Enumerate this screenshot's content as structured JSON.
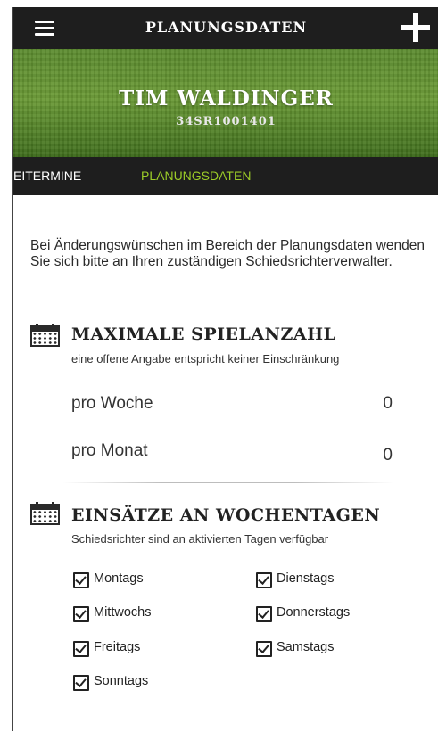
{
  "topbar": {
    "title": "PLANUNGSDATEN",
    "menu_icon": "hamburger-menu-icon",
    "add_icon": "plus-icon"
  },
  "profile": {
    "name": "TIM WALDINGER",
    "id": "34SR1001401"
  },
  "tabs": [
    {
      "label": "EITERMINE",
      "active": false
    },
    {
      "label": "PLANUNGSDATEN",
      "active": true
    }
  ],
  "intro": "Bei Änderungswünschen im Bereich der Planungsdaten wenden Sie sich bitte an Ihren zuständigen Schiedsrichterverwalter.",
  "max_games": {
    "icon": "calendar-icon",
    "title": "MAXIMALE SPIELANZAHL",
    "subtitle": "eine offene Angabe entspricht keiner Einschränkung",
    "rows": [
      {
        "label": "pro Woche",
        "value": "0"
      },
      {
        "label": "pro Monat",
        "value": "0"
      }
    ]
  },
  "weekdays": {
    "icon": "calendar-icon",
    "title": "EINSÄTZE AN WOCHENTAGEN",
    "subtitle": "Schiedsrichter sind an aktivierten Tagen verfügbar",
    "days": [
      {
        "label": "Montags",
        "checked": true
      },
      {
        "label": "Dienstags",
        "checked": true
      },
      {
        "label": "Mittwochs",
        "checked": true
      },
      {
        "label": "Donnerstags",
        "checked": true
      },
      {
        "label": "Freitags",
        "checked": true
      },
      {
        "label": "Samstags",
        "checked": true
      },
      {
        "label": "Sonntags",
        "checked": true
      }
    ]
  },
  "colors": {
    "bar": "#1e1e1e",
    "accent": "#9ccd28",
    "grass": "#5b8b2e"
  }
}
